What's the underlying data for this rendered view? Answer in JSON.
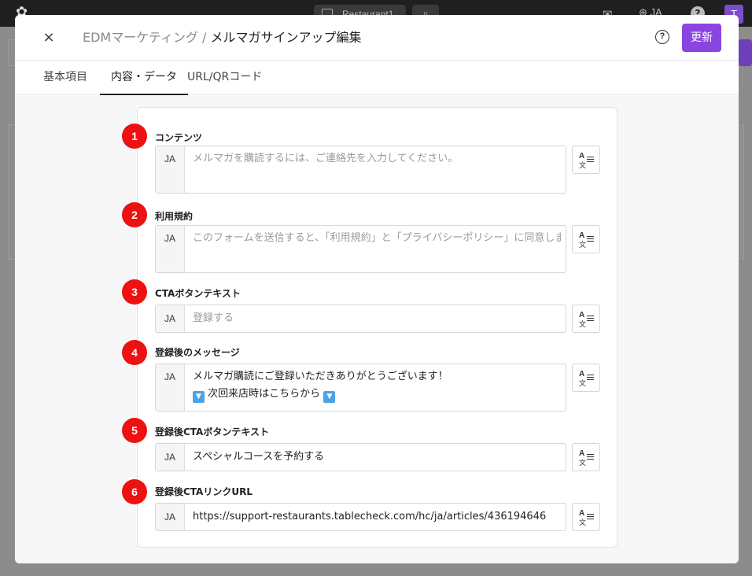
{
  "background": {
    "tab_label": "Restaurant1",
    "lang_label": "JA",
    "avatar_initial": "T"
  },
  "modal": {
    "close_label": "×",
    "breadcrumb": "EDMマーケティング /",
    "title": "メルマガサインアップ編集",
    "help_label": "?",
    "update_label": "更新"
  },
  "tabs": [
    {
      "label": "基本項目"
    },
    {
      "label": "内容・データ"
    },
    {
      "label": "URL/QRコード"
    }
  ],
  "fields": [
    {
      "badge": "1",
      "label": "コンテンツ",
      "lang": "JA",
      "value": "メルマガを購読するには、ご連絡先を入力してください。",
      "placeholder": true
    },
    {
      "badge": "2",
      "label": "利用規約",
      "lang": "JA",
      "value": "このフォームを送信すると、「利用規約」と「プライバシーポリシー」に同意します。",
      "placeholder": true
    },
    {
      "badge": "3",
      "label": "CTAボタンテキスト",
      "lang": "JA",
      "value": "登録する",
      "placeholder": true
    },
    {
      "badge": "4",
      "label": "登録後のメッセージ",
      "lang": "JA",
      "value_line1": "メルマガ購読にご登録いただきありがとうございます！",
      "value_line2": "次回来店時はこちらから",
      "emoji": "▼"
    },
    {
      "badge": "5",
      "label": "登録後CTAボタンテキスト",
      "lang": "JA",
      "value": "スペシャルコースを予約する"
    },
    {
      "badge": "6",
      "label": "登録後CTAリンクURL",
      "lang": "JA",
      "value": "https://support-restaurants.tablecheck.com/hc/ja/articles/436194646"
    }
  ],
  "translate_icon": {
    "glyph_top": "A",
    "glyph_bottom": "文"
  },
  "colors": {
    "accent": "#8a45e0",
    "badge": "#ee1111"
  }
}
